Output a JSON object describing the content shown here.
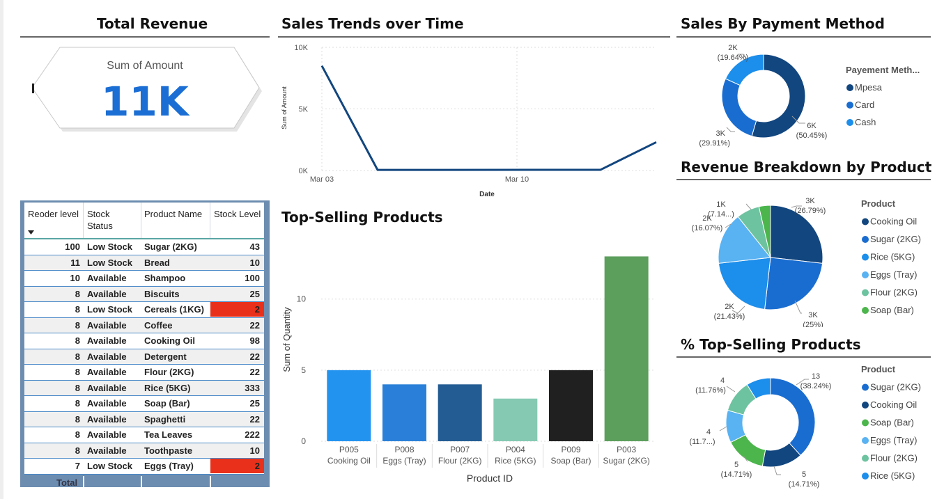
{
  "total_revenue": {
    "title": "Total Revenue",
    "label": "Sum of Amount",
    "value": "11K"
  },
  "stock_table": {
    "headers": [
      "Reoder level",
      "Stock Status",
      "Product Name",
      "Stock Level"
    ],
    "sort_icon": "sort-desc-icon",
    "rows": [
      {
        "reorder": "100",
        "status": "Low Stock",
        "product": "Sugar (2KG)",
        "level": "43",
        "highlight": false
      },
      {
        "reorder": "11",
        "status": "Low Stock",
        "product": "Bread",
        "level": "10",
        "highlight": false
      },
      {
        "reorder": "10",
        "status": "Available",
        "product": "Shampoo",
        "level": "100",
        "highlight": false
      },
      {
        "reorder": "8",
        "status": "Available",
        "product": "Biscuits",
        "level": "25",
        "highlight": false
      },
      {
        "reorder": "8",
        "status": "Low Stock",
        "product": "Cereals (1KG)",
        "level": "2",
        "highlight": true
      },
      {
        "reorder": "8",
        "status": "Available",
        "product": "Coffee",
        "level": "22",
        "highlight": false
      },
      {
        "reorder": "8",
        "status": "Available",
        "product": "Cooking Oil",
        "level": "98",
        "highlight": false
      },
      {
        "reorder": "8",
        "status": "Available",
        "product": "Detergent",
        "level": "22",
        "highlight": false
      },
      {
        "reorder": "8",
        "status": "Available",
        "product": "Flour (2KG)",
        "level": "22",
        "highlight": false
      },
      {
        "reorder": "8",
        "status": "Available",
        "product": "Rice (5KG)",
        "level": "333",
        "highlight": false
      },
      {
        "reorder": "8",
        "status": "Available",
        "product": "Soap (Bar)",
        "level": "25",
        "highlight": false
      },
      {
        "reorder": "8",
        "status": "Available",
        "product": "Spaghetti",
        "level": "22",
        "highlight": false
      },
      {
        "reorder": "8",
        "status": "Available",
        "product": "Tea Leaves",
        "level": "222",
        "highlight": false
      },
      {
        "reorder": "8",
        "status": "Available",
        "product": "Toothpaste",
        "level": "10",
        "highlight": false
      },
      {
        "reorder": "7",
        "status": "Low Stock",
        "product": "Eggs (Tray)",
        "level": "2",
        "highlight": true
      }
    ],
    "total_label": "Total",
    "highlight_color": "#E8301A"
  },
  "colors": {
    "mpesa": "#12467F",
    "card": "#1A6DD0",
    "cash": "#1C8EEB",
    "cooking_oil": "#12467F",
    "sugar": "#1A6DD0",
    "rice": "#1C8EEB",
    "eggs": "#59B2F2",
    "flour": "#6DC3A0",
    "soap": "#4CB54C",
    "line": "#12467F"
  },
  "chart_data": [
    {
      "id": "sales_trend",
      "type": "line",
      "title": "Sales Trends over Time",
      "xlabel": "Date",
      "ylabel": "Sum of Amount",
      "x_ticks": [
        "Mar 03",
        "Mar 10"
      ],
      "y_ticks": [
        "10K",
        "5K",
        "0K"
      ],
      "ylim": [
        0,
        10000
      ],
      "grid": true,
      "points": [
        {
          "x": "2025-03-03",
          "y": 8500
        },
        {
          "x": "2025-03-05",
          "y": 50
        },
        {
          "x": "2025-03-13",
          "y": 60
        },
        {
          "x": "2025-03-15",
          "y": 2300
        }
      ]
    },
    {
      "id": "top_selling",
      "type": "bar",
      "title": "Top-Selling Products",
      "xlabel": "Product ID",
      "ylabel": "Sum of Quantity",
      "ylim": [
        0,
        14
      ],
      "y_ticks": [
        "10",
        "5",
        "0"
      ],
      "grid": true,
      "categories": [
        {
          "id": "P005",
          "name": "Cooking Oil",
          "value": 5,
          "color": "#2393F0"
        },
        {
          "id": "P008",
          "name": "Eggs (Tray)",
          "value": 4,
          "color": "#2A80D8"
        },
        {
          "id": "P007",
          "name": "Flour (2KG)",
          "value": 4,
          "color": "#235C93"
        },
        {
          "id": "P004",
          "name": "Rice (5KG)",
          "value": 3,
          "color": "#86C9B2"
        },
        {
          "id": "P009",
          "name": "Soap (Bar)",
          "value": 5,
          "color": "#202020"
        },
        {
          "id": "P003",
          "name": "Sugar (2KG)",
          "value": 13,
          "color": "#5C9E5C"
        }
      ]
    },
    {
      "id": "payment_method",
      "type": "pie",
      "title": "Sales By Payment Method",
      "legend_title": "Payement Meth...",
      "legend_position": "right",
      "slices": [
        {
          "name": "Mpesa",
          "value": 6,
          "label": "6K",
          "pct": "(50.45%)"
        },
        {
          "name": "Card",
          "value": 3,
          "label": "3K",
          "pct": "(29.91%)"
        },
        {
          "name": "Cash",
          "value": 2,
          "label": "2K",
          "pct": "(19.64%)"
        }
      ]
    },
    {
      "id": "revenue_product",
      "type": "pie",
      "title": "Revenue Breakdown by Product",
      "legend_title": "Product",
      "legend_position": "right",
      "slices": [
        {
          "name": "Cooking Oil",
          "value": 26.79,
          "label": "3K",
          "pct": "(26.79%)"
        },
        {
          "name": "Sugar (2KG)",
          "value": 25,
          "label": "3K",
          "pct": "(25%)"
        },
        {
          "name": "Rice (5KG)",
          "value": 21.43,
          "label": "2K",
          "pct": "(21.43%)"
        },
        {
          "name": "Eggs (Tray)",
          "value": 16.07,
          "label": "2K",
          "pct": "(16.07%)"
        },
        {
          "name": "Flour (2KG)",
          "value": 7.14,
          "label": "1K",
          "pct": "(7.14...)"
        },
        {
          "name": "Soap (Bar)",
          "value": 3.57,
          "label": "",
          "pct": ""
        }
      ]
    },
    {
      "id": "pct_top_selling",
      "type": "pie",
      "title": "% Top-Selling Products",
      "legend_title": "Product",
      "legend_position": "right",
      "slices": [
        {
          "name": "Sugar (2KG)",
          "value": 13,
          "label": "13",
          "pct": "(38.24%)"
        },
        {
          "name": "Cooking Oil",
          "value": 5,
          "label": "5",
          "pct": "(14.71%)"
        },
        {
          "name": "Soap (Bar)",
          "value": 5,
          "label": "5",
          "pct": "(14.71%)"
        },
        {
          "name": "Eggs (Tray)",
          "value": 4,
          "label": "4",
          "pct": "(11.7...)"
        },
        {
          "name": "Flour (2KG)",
          "value": 4,
          "label": "4",
          "pct": "(11.76%)"
        },
        {
          "name": "Rice (5KG)",
          "value": 3,
          "label": "",
          "pct": ""
        }
      ]
    }
  ]
}
